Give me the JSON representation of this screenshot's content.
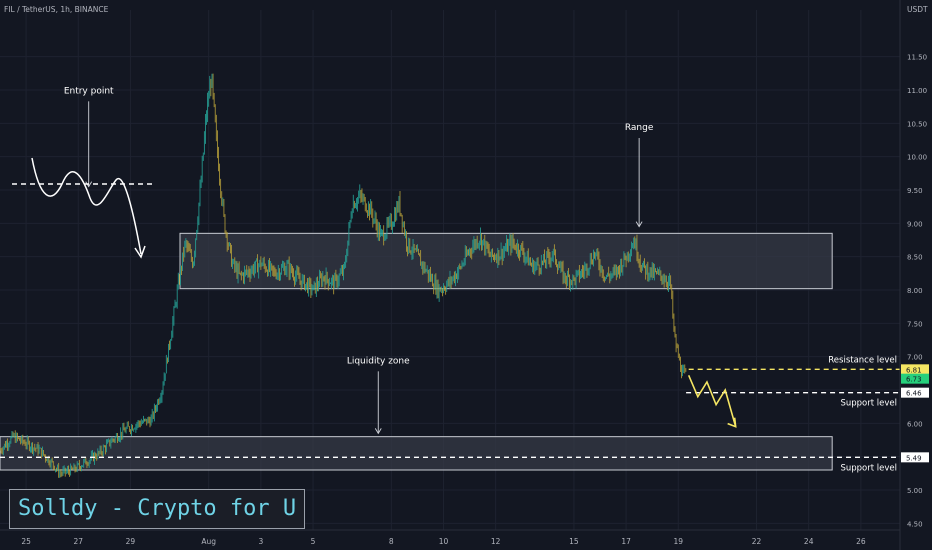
{
  "header": {
    "symbol_line": "FIL / TetherUS, 1h, BINANCE",
    "currency": "USDT"
  },
  "brand": {
    "text": "Solldy - Crypto for U"
  },
  "colors": {
    "background": "#131722",
    "axis_text": "#b2b5be",
    "candle_up": "#26a69a",
    "candle_down": "#b9a23a",
    "zone_fill": "#363a45",
    "zone_border": "#c9ccd3",
    "resistance": "#f5e663",
    "support": "#ffffff",
    "arrow": "#f5e663",
    "annotation": "#ffffff",
    "brand_text": "#6fd3e6"
  },
  "chart_data": {
    "type": "line",
    "title": "FIL / TetherUS, 1h, BINANCE",
    "x_ticks": [
      {
        "label": "25",
        "day": 25
      },
      {
        "label": "27",
        "day": 27
      },
      {
        "label": "29",
        "day": 29
      },
      {
        "label": "Aug",
        "day": 32
      },
      {
        "label": "3",
        "day": 34
      },
      {
        "label": "5",
        "day": 36
      },
      {
        "label": "8",
        "day": 39
      },
      {
        "label": "10",
        "day": 41
      },
      {
        "label": "12",
        "day": 43
      },
      {
        "label": "15",
        "day": 46
      },
      {
        "label": "17",
        "day": 48
      },
      {
        "label": "19",
        "day": 50
      },
      {
        "label": "22",
        "day": 53
      },
      {
        "label": "24",
        "day": 55
      },
      {
        "label": "26",
        "day": 57
      }
    ],
    "x_range_days": [
      24.0,
      58.5
    ],
    "y_ticks": [
      4.5,
      5.0,
      5.5,
      6.0,
      6.5,
      7.0,
      7.5,
      8.0,
      8.5,
      9.0,
      9.5,
      10.0,
      10.5,
      11.0,
      11.5
    ],
    "y_range": [
      4.4,
      12.2
    ],
    "series": [
      {
        "values": [
          [
            24.0,
            5.6
          ],
          [
            24.5,
            5.8
          ],
          [
            25.0,
            5.7
          ],
          [
            25.5,
            5.6
          ],
          [
            26.0,
            5.4
          ],
          [
            26.3,
            5.25
          ],
          [
            26.8,
            5.3
          ],
          [
            27.2,
            5.4
          ],
          [
            27.8,
            5.55
          ],
          [
            28.3,
            5.75
          ],
          [
            28.8,
            5.9
          ],
          [
            29.3,
            6.0
          ],
          [
            29.8,
            6.05
          ],
          [
            30.2,
            6.5
          ],
          [
            30.5,
            7.2
          ],
          [
            30.8,
            8.0
          ],
          [
            31.1,
            8.7
          ],
          [
            31.4,
            8.4
          ],
          [
            31.7,
            9.6
          ],
          [
            31.9,
            10.6
          ],
          [
            32.1,
            11.2
          ],
          [
            32.3,
            10.2
          ],
          [
            32.6,
            9.0
          ],
          [
            32.9,
            8.4
          ],
          [
            33.2,
            8.2
          ],
          [
            33.6,
            8.3
          ],
          [
            34.0,
            8.4
          ],
          [
            34.5,
            8.25
          ],
          [
            35.0,
            8.35
          ],
          [
            35.5,
            8.15
          ],
          [
            36.0,
            8.0
          ],
          [
            36.4,
            8.2
          ],
          [
            36.8,
            8.1
          ],
          [
            37.2,
            8.3
          ],
          [
            37.5,
            9.3
          ],
          [
            37.8,
            9.4
          ],
          [
            38.2,
            9.2
          ],
          [
            38.6,
            8.8
          ],
          [
            39.0,
            9.0
          ],
          [
            39.3,
            9.3
          ],
          [
            39.6,
            8.7
          ],
          [
            40.0,
            8.5
          ],
          [
            40.4,
            8.25
          ],
          [
            40.8,
            8.0
          ],
          [
            41.2,
            8.1
          ],
          [
            41.6,
            8.3
          ],
          [
            42.0,
            8.6
          ],
          [
            42.4,
            8.8
          ],
          [
            42.8,
            8.5
          ],
          [
            43.2,
            8.55
          ],
          [
            43.6,
            8.7
          ],
          [
            44.0,
            8.6
          ],
          [
            44.4,
            8.35
          ],
          [
            44.8,
            8.4
          ],
          [
            45.2,
            8.55
          ],
          [
            45.6,
            8.2
          ],
          [
            46.0,
            8.15
          ],
          [
            46.4,
            8.3
          ],
          [
            46.8,
            8.55
          ],
          [
            47.2,
            8.2
          ],
          [
            47.6,
            8.25
          ],
          [
            48.0,
            8.5
          ],
          [
            48.3,
            8.75
          ],
          [
            48.6,
            8.35
          ],
          [
            49.0,
            8.25
          ],
          [
            49.4,
            8.2
          ],
          [
            49.7,
            8.1
          ],
          [
            49.85,
            7.3
          ],
          [
            50.0,
            7.0
          ],
          [
            50.15,
            6.75
          ],
          [
            50.3,
            6.72
          ]
        ]
      }
    ],
    "zones": [
      {
        "label": "Range",
        "from_day": 30.9,
        "to_day": 55.9,
        "low": 8.02,
        "high": 8.85
      },
      {
        "label": "Liquidity zone",
        "from_day": 24.0,
        "to_day": 55.9,
        "low": 5.3,
        "high": 5.8
      }
    ],
    "levels": [
      {
        "label": "Resistance level",
        "value": 6.81,
        "tag": "6.81",
        "from_day": 50.4
      },
      {
        "label": "Support level",
        "value": 6.46,
        "tag": "6.46",
        "from_day": 50.3
      },
      {
        "label": "Support level",
        "value": 5.49,
        "tag": "5.49",
        "from_day": 24.0
      }
    ],
    "last_price": {
      "tag": "6.73",
      "value": 6.73
    },
    "projection": [
      [
        50.4,
        6.72
      ],
      [
        50.75,
        6.4
      ],
      [
        51.1,
        6.62
      ],
      [
        51.45,
        6.28
      ],
      [
        51.8,
        6.5
      ],
      [
        52.2,
        5.95
      ]
    ],
    "annotations": [
      {
        "text": "Entry point",
        "day": 27.4,
        "price": 10.95
      },
      {
        "text": "Range",
        "day": 48.5,
        "price": 10.4
      },
      {
        "text": "Liquidity zone",
        "day": 38.5,
        "price": 6.9
      }
    ]
  }
}
